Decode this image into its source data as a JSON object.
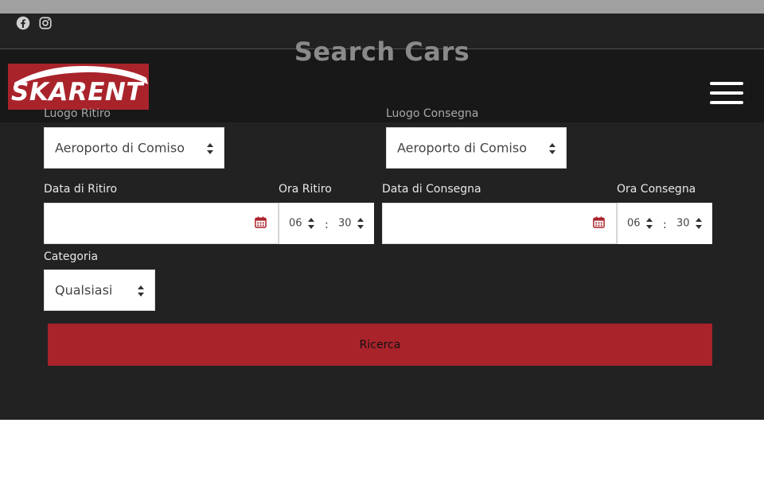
{
  "page": {
    "title": "Search Cars"
  },
  "social": {
    "facebook_icon": "facebook-icon",
    "instagram_icon": "instagram-icon"
  },
  "logo": {
    "text": "SKARENT"
  },
  "form": {
    "pickup_location": {
      "label": "Luogo Ritiro",
      "value": "Aeroporto di Comiso"
    },
    "dropoff_location": {
      "label": "Luogo Consegna",
      "value": "Aeroporto di Comiso"
    },
    "pickup_date": {
      "label": "Data di Ritiro",
      "value": ""
    },
    "pickup_time": {
      "label": "Ora Ritiro",
      "hour": "06",
      "separator": ":",
      "minute": "30"
    },
    "dropoff_date": {
      "label": "Data di Consegna",
      "value": ""
    },
    "dropoff_time": {
      "label": "Ora Consegna",
      "hour": "06",
      "separator": ":",
      "minute": "30"
    },
    "category": {
      "label": "Categoria",
      "value": "Qualsiasi"
    },
    "submit_label": "Ricerca"
  },
  "colors": {
    "accent": "#a9232b",
    "background": "#222222",
    "header": "#181818"
  }
}
